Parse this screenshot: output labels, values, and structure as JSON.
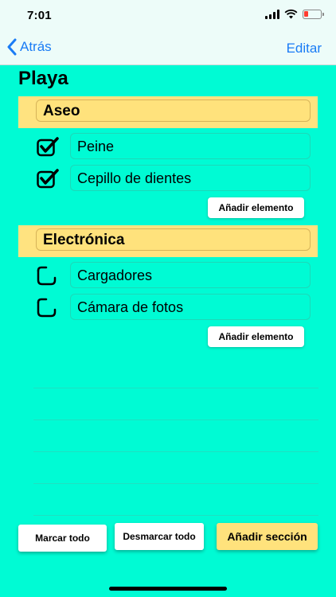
{
  "status_bar": {
    "time": "7:01"
  },
  "nav": {
    "back_label": "Atrás",
    "edit_label": "Editar"
  },
  "page": {
    "title": "Playa"
  },
  "sections": [
    {
      "title": "Aseo",
      "items": [
        {
          "label": "Peine",
          "checked": true
        },
        {
          "label": "Cepillo de dientes",
          "checked": true
        }
      ],
      "add_item_label": "Añadir elemento"
    },
    {
      "title": "Electrónica",
      "items": [
        {
          "label": "Cargadores",
          "checked": false
        },
        {
          "label": "Cámara de fotos",
          "checked": false
        }
      ],
      "add_item_label": "Añadir elemento"
    }
  ],
  "toolbar": {
    "mark_all_label": "Marcar todo",
    "unmark_all_label": "Desmarcar todo",
    "add_section_label": "Añadir sección"
  },
  "colors": {
    "background": "#00FBD4",
    "section": "#FFE380",
    "accent": "#1A7CF5",
    "battery_low": "#FF3B30"
  }
}
